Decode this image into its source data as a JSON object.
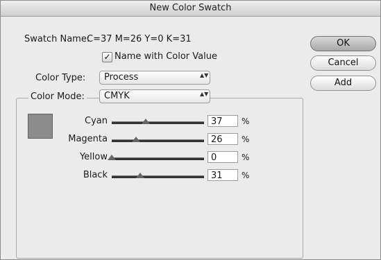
{
  "dialog": {
    "title": "New Color Swatch"
  },
  "swatch_name": {
    "label": "Swatch Name:",
    "value": "C=37 M=26 Y=0 K=31"
  },
  "name_with_value": {
    "label": "Name with Color Value",
    "checked": true,
    "check_glyph": "✓"
  },
  "color_type": {
    "label": "Color Type:",
    "value": "Process"
  },
  "color_mode": {
    "label": "Color Mode:",
    "value": "CMYK"
  },
  "buttons": {
    "ok": "OK",
    "cancel": "Cancel",
    "add": "Add"
  },
  "preview": {
    "color": "#8c8c8c"
  },
  "sliders": [
    {
      "label": "Cyan",
      "value": "37",
      "unit": "%",
      "fraction": 0.37
    },
    {
      "label": "Magenta",
      "value": "26",
      "unit": "%",
      "fraction": 0.26
    },
    {
      "label": "Yellow",
      "value": "0",
      "unit": "%",
      "fraction": 0.0
    },
    {
      "label": "Black",
      "value": "31",
      "unit": "%",
      "fraction": 0.31
    }
  ],
  "icons": {
    "popup_arrows": "▲▼"
  }
}
